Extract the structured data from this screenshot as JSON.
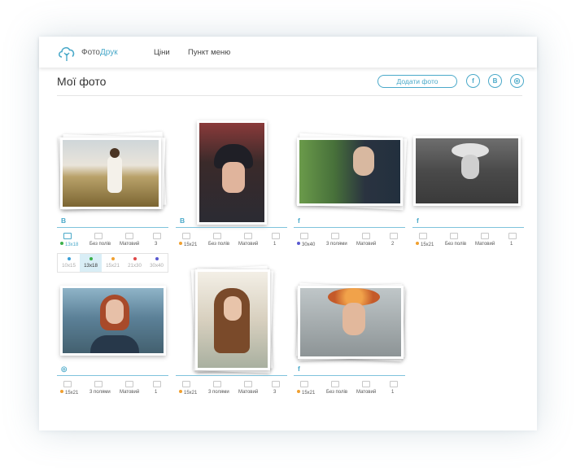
{
  "header": {
    "brand_part1": "Фото",
    "brand_part2": "Друк",
    "nav": [
      "Ціни",
      "Пункт меню"
    ]
  },
  "page": {
    "title": "Мої фото",
    "add_button": "Додати фото",
    "social": [
      "f",
      "B",
      "◎"
    ]
  },
  "cards": [
    {
      "source": "B",
      "size": "13x18",
      "margins": "Без полів",
      "finish": "Матовий",
      "qty": "3",
      "dot": "#3cb04a"
    },
    {
      "source": "B",
      "size": "15x21",
      "margins": "Без полів",
      "finish": "Матовий",
      "qty": "1",
      "dot": "#f0a030"
    },
    {
      "source": "f",
      "size": "30x40",
      "margins": "3 полями",
      "finish": "Матовий",
      "qty": "2",
      "dot": "#5a5ad0"
    },
    {
      "source": "f",
      "size": "15x21",
      "margins": "Без полів",
      "finish": "Матовий",
      "qty": "1",
      "dot": "#f0a030"
    },
    {
      "source": "◎",
      "size": "15x21",
      "margins": "3 полями",
      "finish": "Матовий",
      "qty": "1",
      "dot": "#f0a030"
    },
    {
      "source": "",
      "size": "15x21",
      "margins": "3 полями",
      "finish": "Матовий",
      "qty": "3",
      "dot": "#f0a030"
    },
    {
      "source": "f",
      "size": "15x21",
      "margins": "Без полів",
      "finish": "Матовий",
      "qty": "1",
      "dot": "#f0a030"
    }
  ],
  "size_picker": {
    "options": [
      {
        "label": "10x15",
        "color": "#3aa0d8"
      },
      {
        "label": "13x18",
        "color": "#3cb04a"
      },
      {
        "label": "15x21",
        "color": "#f0a030"
      },
      {
        "label": "21x30",
        "color": "#e04848"
      },
      {
        "label": "30x40",
        "color": "#5a5ad0"
      }
    ],
    "selected": "13x18"
  },
  "colors": {
    "accent": "#4aa9c9"
  }
}
